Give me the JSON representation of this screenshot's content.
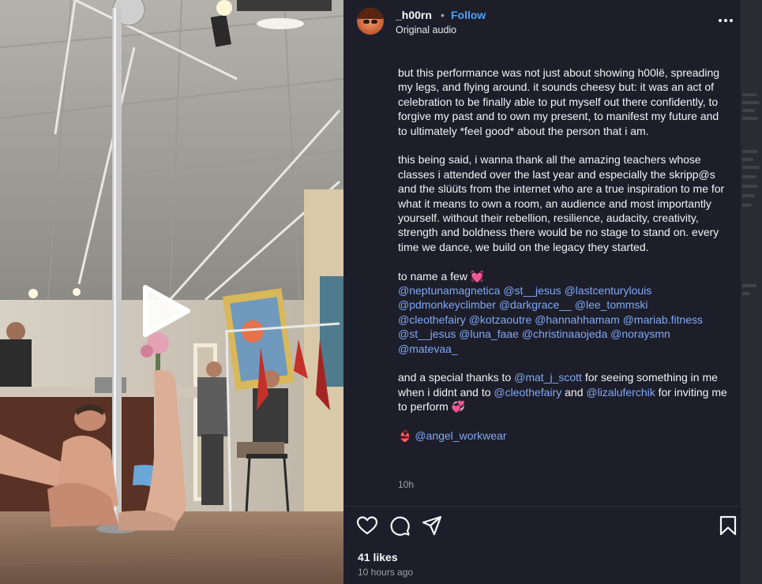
{
  "header": {
    "username": "_h00rn",
    "separator": "•",
    "follow_label": "Follow",
    "audio": "Original audio"
  },
  "caption": {
    "p1": "but this performance was not just about showing h00lë, spreading my legs, and flying around. it sounds cheesy but: it was an act of celebration to be finally able to put myself out there confidently, to forgive my past and to own my present, to manifest my future and to ultimately *feel good* about the person that i am.",
    "p2": "this being said, i wanna thank all the amazing teachers whose classes i attended over the last year and especially the skripp@s and the slüüts from the internet who are a true inspiration to me for what it means to own a room, an audience and most importantly yourself. without their rebellion, resilience, audacity, creativity, strength and boldness there would be no stage to stand on. every time we dance, we build on the legacy they started.",
    "p3_intro": "to name a few",
    "heart_emoji": "💓",
    "mentions": [
      "@neptunamagnetica",
      "@st__jesus",
      "@lastcenturylouis",
      "@pdmonkeyclimber",
      "@darkgrace__",
      "@lee_tommski",
      "@cleothefairy",
      "@kotzaoutre",
      "@hannahhamam",
      "@mariab.fitness",
      "@st__jesus",
      "@luna_faae",
      "@christinaaojeda",
      "@noraysmn",
      "@matevaa_"
    ],
    "p4_a": "and a special thanks to",
    "p4_m1": "@mat_j_scott",
    "p4_b": "for seeing something in me when i didnt and to",
    "p4_m2": "@cleothefairy",
    "p4_c": "and",
    "p4_m3": "@lizaluferchik",
    "p4_d": "for inviting me to perform",
    "sparkle_emoji": "💞",
    "bikini_emoji": "👙",
    "workwear_mention": "@angel_workwear",
    "time_short": "10h"
  },
  "footer": {
    "likes": "41 likes",
    "posted": "10 hours ago"
  },
  "icons": {
    "more": "more-options-icon",
    "like": "heart-icon",
    "comment": "comment-icon",
    "share": "share-icon",
    "save": "bookmark-icon",
    "play": "play-icon"
  },
  "colors": {
    "panel_bg": "#1d1e2a",
    "link": "#7fa8f5",
    "follow": "#4aa3f2"
  }
}
